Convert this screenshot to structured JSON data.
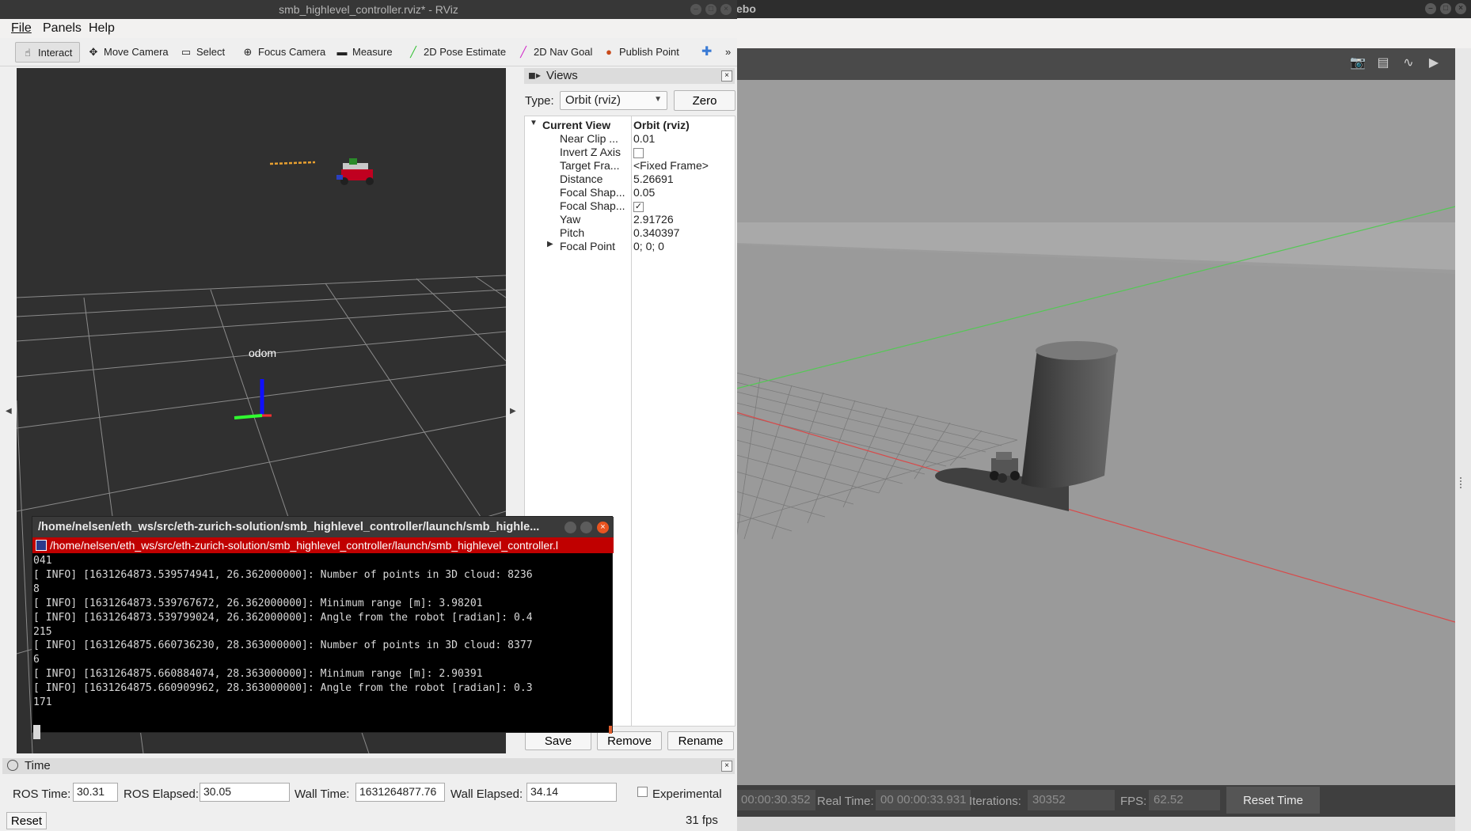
{
  "gazebo": {
    "title_fragment": "ebo",
    "bottom": {
      "sim_time_value": "00:00:30.352",
      "real_time_label": "Real Time:",
      "real_time_value": "00 00:00:33.931",
      "iterations_label": "Iterations:",
      "iterations_value": "30352",
      "fps_label": "FPS:",
      "fps_value": "62.52",
      "reset_time_label": "Reset Time"
    }
  },
  "rviz": {
    "title": "smb_highlevel_controller.rviz* - RViz",
    "menu": [
      "File",
      "Panels",
      "Help"
    ],
    "tools": [
      "Interact",
      "Move Camera",
      "Select",
      "Focus Camera",
      "Measure",
      "2D Pose Estimate",
      "2D Nav Goal",
      "Publish Point"
    ],
    "overflow": "»",
    "viewport": {
      "frame_label": "odom"
    },
    "views_panel": {
      "title": "Views",
      "type_label": "Type:",
      "type_value": "Orbit (rviz)",
      "zero_label": "Zero",
      "current_view_label": "Current View",
      "current_view_value": "Orbit (rviz)",
      "properties": [
        {
          "key": "Near Clip ...",
          "value": "0.01"
        },
        {
          "key": "Invert Z Axis",
          "value": ""
        },
        {
          "key": "Target Fra...",
          "value": "<Fixed Frame>"
        },
        {
          "key": "Distance",
          "value": "5.26691"
        },
        {
          "key": "Focal Shap...",
          "value": "0.05"
        },
        {
          "key": "Focal Shap...",
          "value": "✓"
        },
        {
          "key": "Yaw",
          "value": "2.91726"
        },
        {
          "key": "Pitch",
          "value": "0.340397"
        },
        {
          "key": "Focal Point",
          "value": "0; 0; 0"
        }
      ],
      "buttons": [
        "Save",
        "Remove",
        "Rename"
      ]
    },
    "time_panel": {
      "title": "Time",
      "ros_time_label": "ROS Time:",
      "ros_time_value": "30.31",
      "ros_elapsed_label": "ROS Elapsed:",
      "ros_elapsed_value": "30.05",
      "wall_time_label": "Wall Time:",
      "wall_time_value": "1631264877.76",
      "wall_elapsed_label": "Wall Elapsed:",
      "wall_elapsed_value": "34.14",
      "experimental_label": "Experimental",
      "reset_label": "Reset",
      "fps": "31 fps"
    }
  },
  "terminal": {
    "title": "/home/nelsen/eth_ws/src/eth-zurich-solution/smb_highlevel_controller/launch/smb_highle...",
    "tab": "/home/nelsen/eth_ws/src/eth-zurich-solution/smb_highlevel_controller/launch/smb_highlevel_controller.l",
    "lines": [
      "041",
      "[ INFO] [1631264873.539574941, 26.362000000]: Number of points in 3D cloud: 8236",
      "8",
      "[ INFO] [1631264873.539767672, 26.362000000]: Minimum range [m]: 3.98201",
      "[ INFO] [1631264873.539799024, 26.362000000]: Angle from the robot [radian]: 0.4",
      "215",
      "[ INFO] [1631264875.660736230, 28.363000000]: Number of points in 3D cloud: 8377",
      "6",
      "[ INFO] [1631264875.660884074, 28.363000000]: Minimum range [m]: 2.90391",
      "[ INFO] [1631264875.660909962, 28.363000000]: Angle from the robot [radian]: 0.3",
      "171"
    ]
  },
  "colors": {
    "terminal_tab": "#c00000",
    "close_button": "#e95420",
    "axis_x": "#ff3030",
    "axis_y": "#30ff30",
    "axis_z": "#1010ff"
  }
}
